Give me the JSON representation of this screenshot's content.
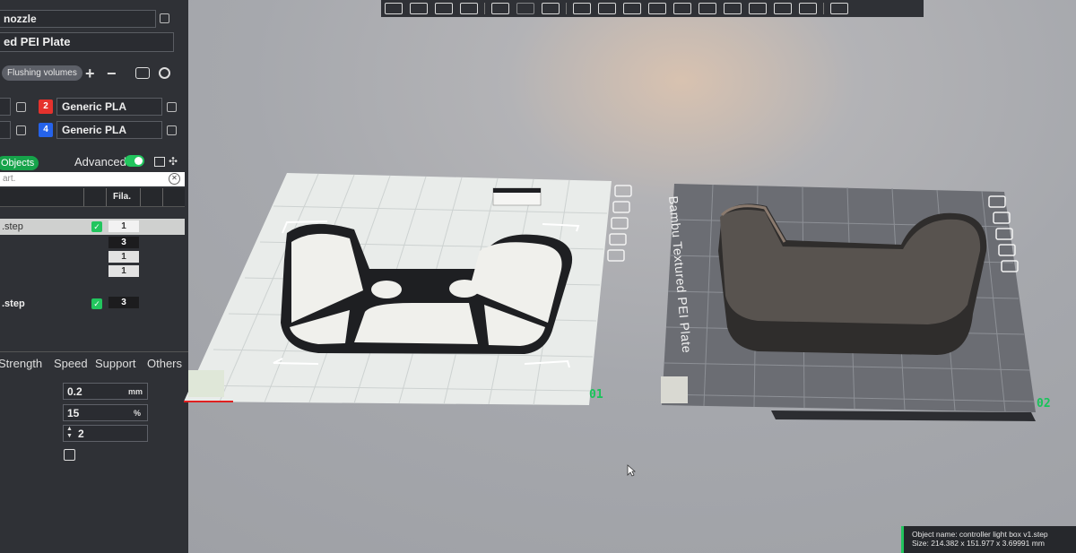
{
  "sidebar": {
    "printer_name": "nozzle",
    "plate_type": "ed PEI Plate",
    "flushing_label": "Flushing volumes",
    "filaments": [
      {
        "number": "2",
        "name": "Generic PLA",
        "color": "#e5322d"
      },
      {
        "number": "4",
        "name": "Generic PLA",
        "color": "#2563eb"
      }
    ],
    "objects_tab": "Objects",
    "advanced_label": "Advanced",
    "search_placeholder": "art.",
    "fila_header": "Fila.",
    "rows": [
      {
        "name": ".step",
        "fila": "1",
        "checked": true
      },
      {
        "name": "",
        "fila": "3",
        "checked": false
      },
      {
        "name": "",
        "fila": "1",
        "checked": false
      },
      {
        "name": "",
        "fila": "1",
        "checked": false
      },
      {
        "name": ".step",
        "fila": "3",
        "checked": true
      }
    ],
    "param_tabs": [
      "Strength",
      "Speed",
      "Support",
      "Others"
    ],
    "params": [
      {
        "value": "0.2",
        "unit": "mm"
      },
      {
        "value": "15",
        "unit": "%"
      },
      {
        "value": "2",
        "unit": ""
      }
    ]
  },
  "viewport": {
    "plate1_number": "01",
    "plate2_number": "02",
    "plate2_label": "Bambu Textured PEI Plate",
    "status": {
      "name_line": "Object name: controller light box v1.step",
      "size_line": "Size: 214.382 x 151.977 x 3.69991 mm"
    }
  },
  "colors": {
    "accent": "#22c55e",
    "panel": "#2f3136"
  }
}
